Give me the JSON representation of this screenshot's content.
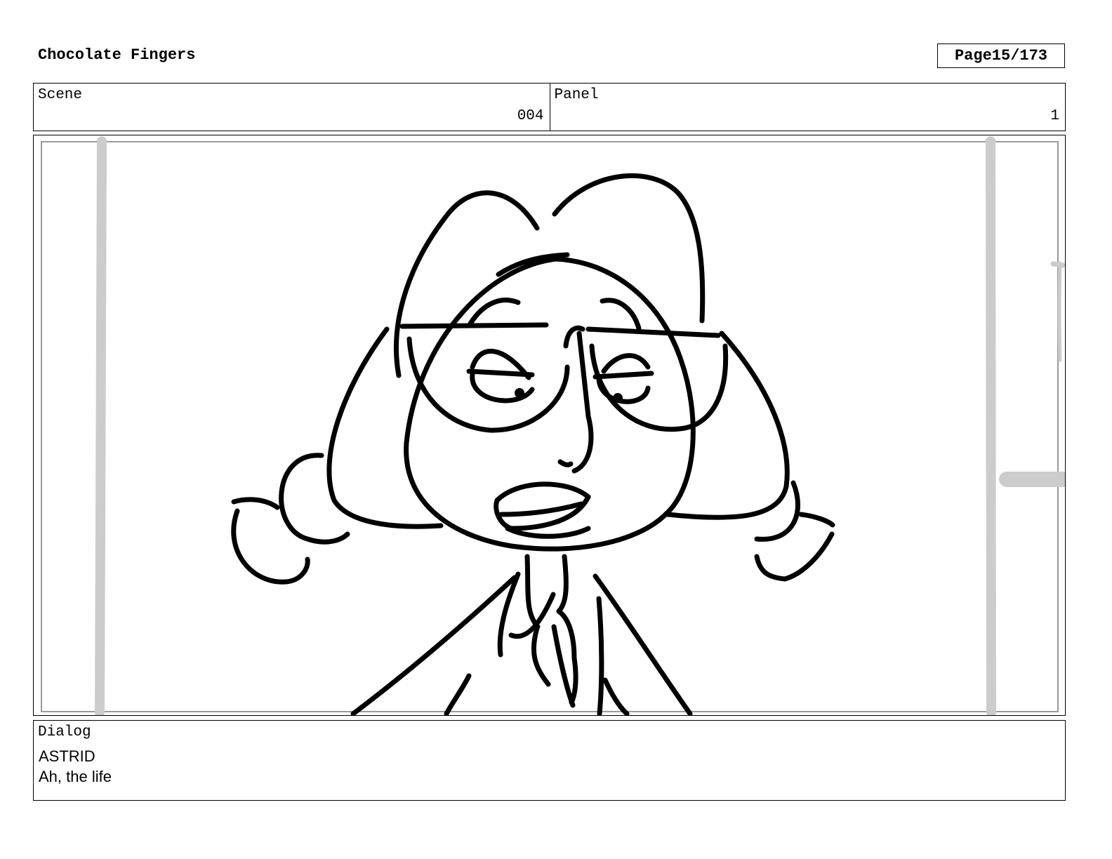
{
  "header": {
    "title": "Chocolate Fingers",
    "page_label": "Page",
    "page_number": "15/173"
  },
  "meta": {
    "scene_label": "Scene",
    "scene_value": "004",
    "panel_label": "Panel",
    "panel_value": "1"
  },
  "dialog": {
    "label": "Dialog",
    "speaker": "ASTRID",
    "line": "Ah, the life"
  }
}
